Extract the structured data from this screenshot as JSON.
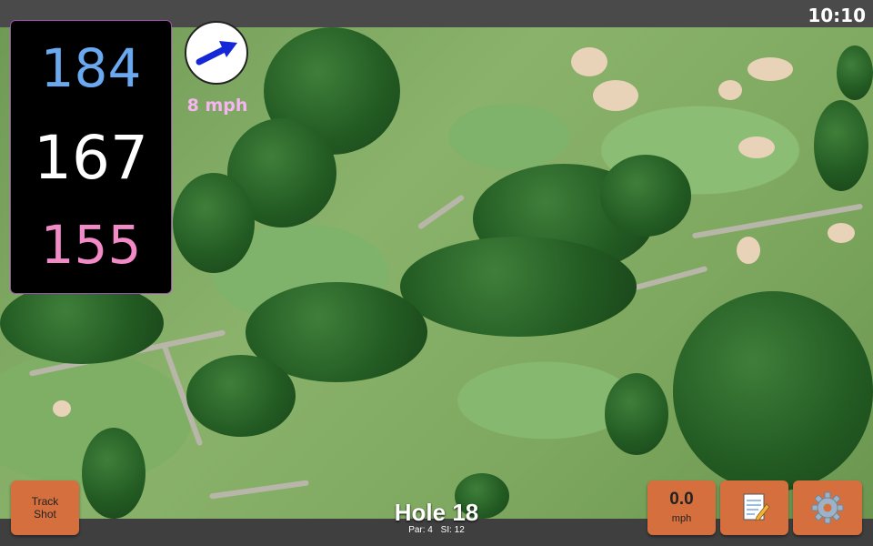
{
  "status_bar": {
    "time": "10:10"
  },
  "distances": {
    "back": "184",
    "middle": "167",
    "front": "155"
  },
  "wind": {
    "speed": "8 mph",
    "arrow_icon": "wind-arrow-icon"
  },
  "hole": {
    "title": "Hole 18",
    "par": "Par: 4",
    "stroke_index": "SI: 12"
  },
  "buttons": {
    "track_shot_line1": "Track",
    "track_shot_line2": "Shot",
    "speed_value": "0.0",
    "speed_unit": "mph",
    "notes_icon": "notepad-icon",
    "settings_icon": "gear-icon"
  },
  "colors": {
    "back": "#6aa8f0",
    "middle": "#ffffff",
    "front": "#f38ac8",
    "wind_text": "#f6b5f0",
    "button": "#d5703e"
  }
}
